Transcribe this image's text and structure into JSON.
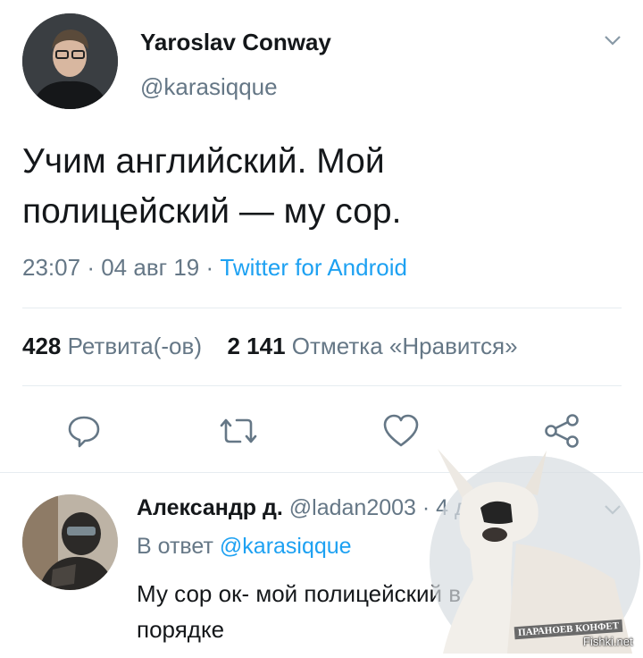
{
  "tweet": {
    "author_name": "Yaroslav Conway",
    "author_handle": "@karasiqque",
    "text_line1": "Учим английский. Мой",
    "text_line2": "полицейский — му сор.",
    "time": "23:07",
    "sep1": "·",
    "date": "04 авг 19",
    "sep2": "·",
    "source": "Twitter for Android",
    "retweets_count": "428",
    "retweets_label": "Ретвита(-ов)",
    "likes_count": "2 141",
    "likes_label": "Отметка «Нравится»"
  },
  "reply": {
    "author_name": "Александр д.",
    "author_handle": "@ladan2003",
    "sep": "·",
    "age": "4 дн",
    "in_reply_prefix": "В ответ",
    "in_reply_handle": "@karasiqque",
    "text_line1": "Му сор ок- мой полицейский в",
    "text_line2": "порядке"
  },
  "watermark": {
    "stamp_text": "ПАРАНОЕВ КОНФЕТ",
    "site": "Fishki.net"
  },
  "icons": {
    "reply": "comment-icon",
    "retweet": "retweet-icon",
    "like": "heart-icon",
    "share": "share-icon",
    "menu": "chevron-down-icon"
  },
  "colors": {
    "link": "#1da1f2",
    "muted": "#657786",
    "text": "#14171a",
    "divider": "#e6ecf0"
  }
}
